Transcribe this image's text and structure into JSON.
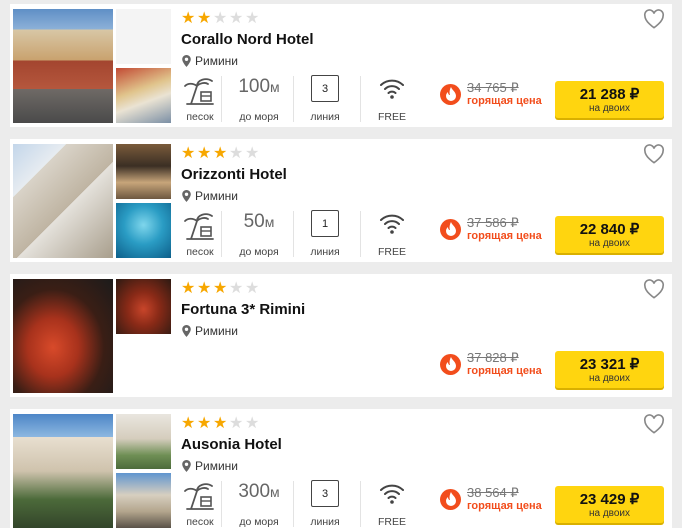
{
  "hotels": [
    {
      "name": "Corallo Nord Hotel",
      "stars": 2,
      "city": "Римини",
      "features": {
        "sand_label": "песок",
        "sea_value": "100",
        "sea_unit": "м",
        "sea_label": "до моря",
        "line_value": "3",
        "line_label": "линия",
        "wifi_label": "FREE"
      },
      "old_price": "34 765 ₽",
      "hot_label": "горящая цена",
      "price": "21 288 ₽",
      "price_note": "на двоих"
    },
    {
      "name": "Orizzonti Hotel",
      "stars": 3,
      "city": "Римини",
      "features": {
        "sand_label": "песок",
        "sea_value": "50",
        "sea_unit": "м",
        "sea_label": "до моря",
        "line_value": "1",
        "line_label": "линия",
        "wifi_label": "FREE"
      },
      "old_price": "37 586 ₽",
      "hot_label": "горящая цена",
      "price": "22 840 ₽",
      "price_note": "на двоих"
    },
    {
      "name": "Fortuna 3* Rimini",
      "stars": 3,
      "city": "Римини",
      "old_price": "37 828 ₽",
      "hot_label": "горящая цена",
      "price": "23 321 ₽",
      "price_note": "на двоих"
    },
    {
      "name": "Ausonia Hotel",
      "stars": 3,
      "city": "Римини",
      "features": {
        "sand_label": "песок",
        "sea_value": "300",
        "sea_unit": "м",
        "sea_label": "до моря",
        "line_value": "3",
        "line_label": "линия",
        "wifi_label": "FREE"
      },
      "old_price": "38 564 ₽",
      "hot_label": "горящая цена",
      "price": "23 429 ₽",
      "price_note": "на двоих"
    }
  ],
  "max_stars": 5,
  "colors": {
    "star": "#f7a700",
    "hot": "#f24d1c",
    "button": "#ffd50f"
  }
}
